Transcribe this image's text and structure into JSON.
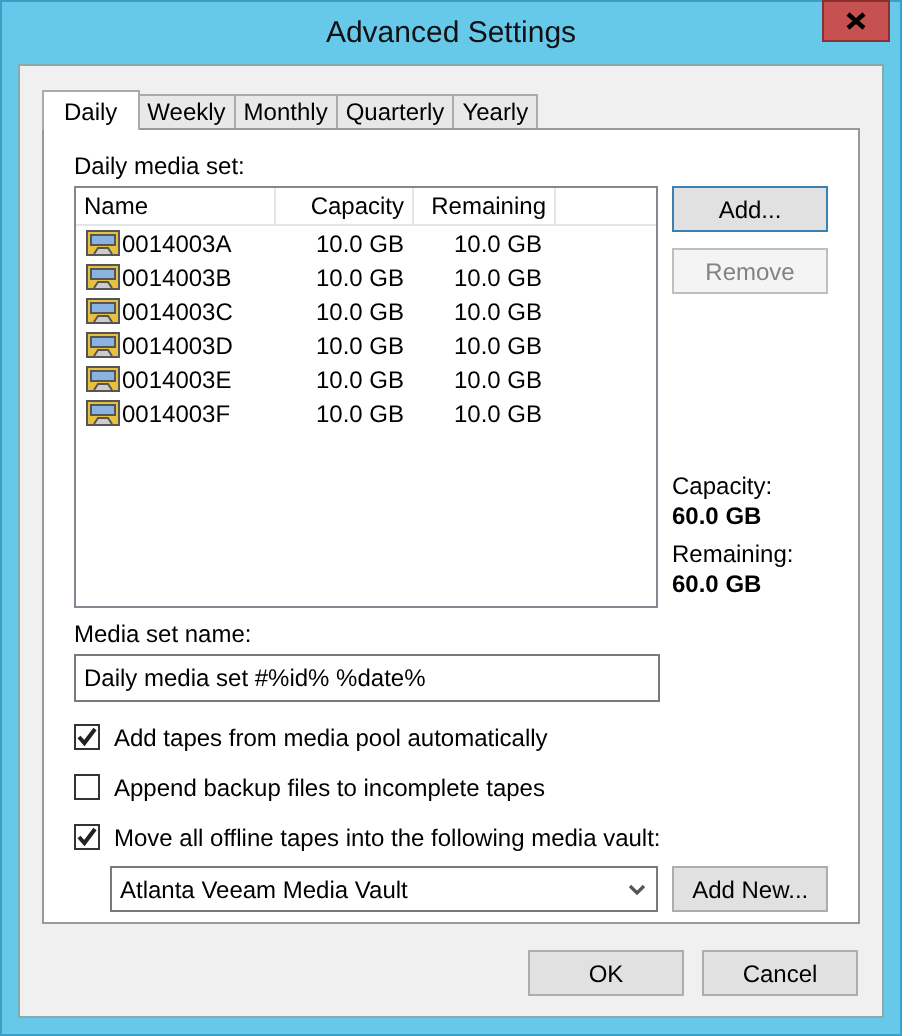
{
  "window": {
    "title": "Advanced Settings"
  },
  "tabs": [
    {
      "label": "Daily",
      "selected": true
    },
    {
      "label": "Weekly",
      "selected": false
    },
    {
      "label": "Monthly",
      "selected": false
    },
    {
      "label": "Quarterly",
      "selected": false
    },
    {
      "label": "Yearly",
      "selected": false
    }
  ],
  "media_set": {
    "label": "Daily media set:",
    "columns": [
      "Name",
      "Capacity",
      "Remaining"
    ],
    "rows": [
      {
        "name": "0014003A",
        "capacity": "10.0 GB",
        "remaining": "10.0 GB"
      },
      {
        "name": "0014003B",
        "capacity": "10.0 GB",
        "remaining": "10.0 GB"
      },
      {
        "name": "0014003C",
        "capacity": "10.0 GB",
        "remaining": "10.0 GB"
      },
      {
        "name": "0014003D",
        "capacity": "10.0 GB",
        "remaining": "10.0 GB"
      },
      {
        "name": "0014003E",
        "capacity": "10.0 GB",
        "remaining": "10.0 GB"
      },
      {
        "name": "0014003F",
        "capacity": "10.0 GB",
        "remaining": "10.0 GB"
      }
    ]
  },
  "side_buttons": [
    {
      "label": "Add...",
      "disabled": false
    },
    {
      "label": "Remove",
      "disabled": true
    }
  ],
  "summary": [
    {
      "label": "Capacity:",
      "value": "60.0 GB"
    },
    {
      "label": "Remaining:",
      "value": "60.0 GB"
    }
  ],
  "name_field": {
    "label": "Media set name:",
    "value": "Daily media set #%id% %date%"
  },
  "options": [
    {
      "label": "Add tapes from media pool automatically",
      "checked": true
    },
    {
      "label": "Append backup files to incomplete tapes",
      "checked": false
    },
    {
      "label": "Move all offline tapes into the following media vault:",
      "checked": true
    }
  ],
  "vault": {
    "value": "Atlanta Veeam Media Vault",
    "button": "Add New..."
  },
  "buttons": [
    "OK",
    "Cancel"
  ]
}
